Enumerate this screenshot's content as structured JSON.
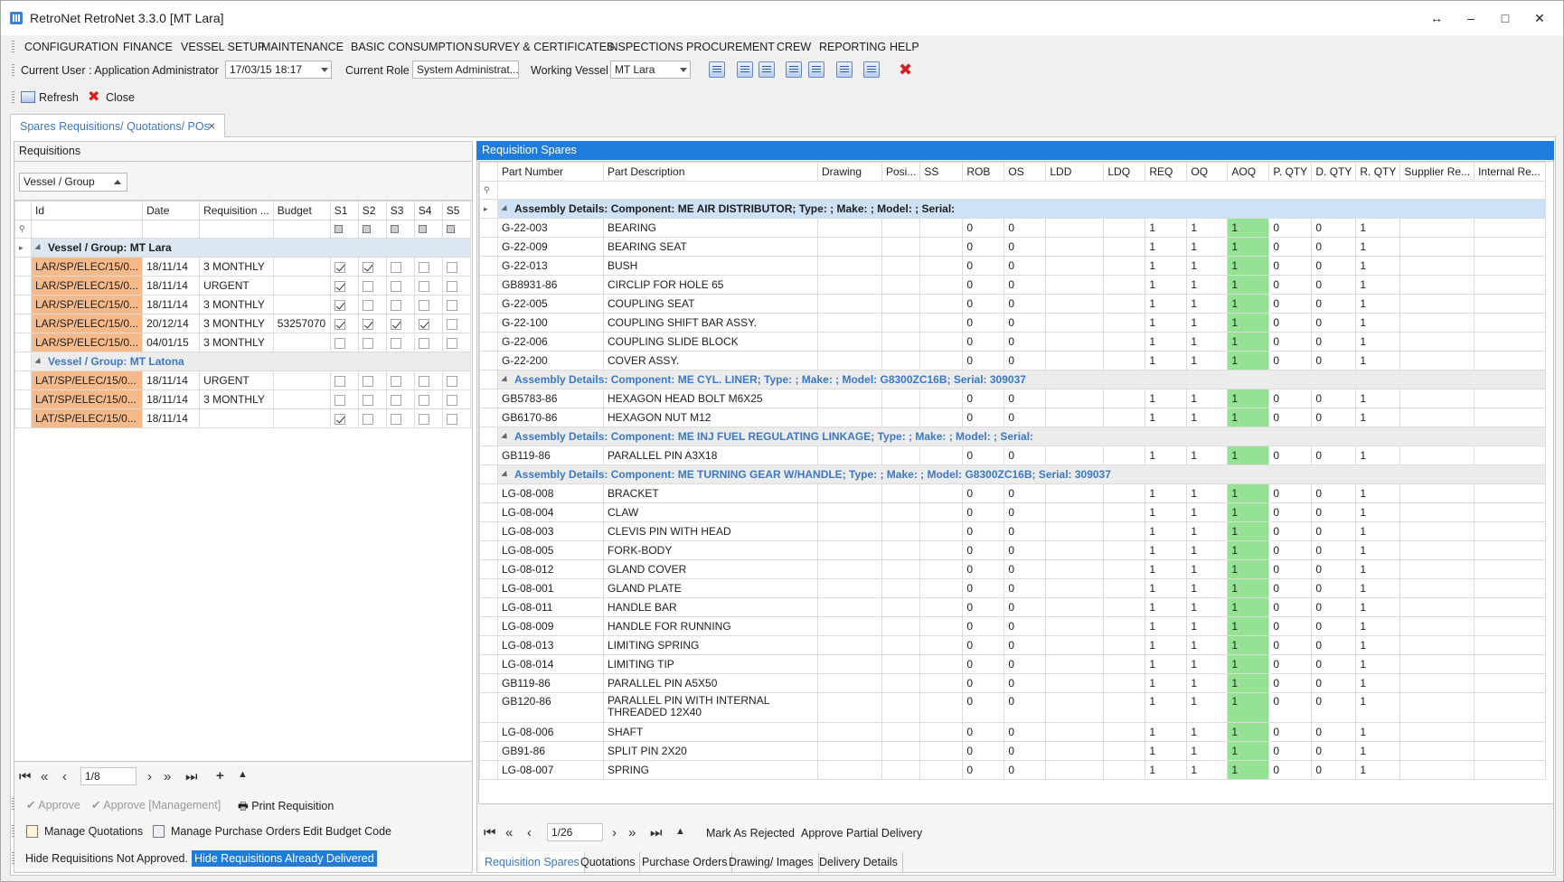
{
  "window": {
    "title": "RetroNet RetroNet 3.3.0 [MT Lara]",
    "controls": [
      "↔",
      "–",
      "□",
      "✕"
    ]
  },
  "menu": [
    "CONFIGURATION",
    "FINANCE",
    "VESSEL SETUP",
    "MAINTENANCE",
    "BASIC CONSUMPTION",
    "SURVEY & CERTIFICATES",
    "INSPECTIONS",
    "PROCUREMENT",
    "CREW",
    "REPORTING",
    "HELP"
  ],
  "toolbar": {
    "current_user_label": "Current User : Application Administrator",
    "date_value": "17/03/15 18:17",
    "current_role_label": "Current Role",
    "role_value": "System Administrat...",
    "working_vessel_label": "Working Vessel",
    "vessel_value": "MT Lara"
  },
  "actions": {
    "refresh": "Refresh",
    "close": "Close"
  },
  "doc_tab": {
    "label": "Spares Requisitions/ Quotations/ POs",
    "close": "×"
  },
  "requisitions": {
    "title": "Requisitions",
    "group_by": "Vessel / Group",
    "columns": [
      "Id",
      "Date",
      "Requisition ...",
      "Budget",
      "S1",
      "S2",
      "S3",
      "S4",
      "S5"
    ],
    "groups": [
      {
        "label": "Vessel / Group: MT Lara",
        "rows": [
          {
            "id": "LAR/SP/ELEC/15/0...",
            "date": "18/11/14",
            "req": "3 MONTHLY",
            "budget": "",
            "s": [
              true,
              true,
              false,
              false,
              false
            ]
          },
          {
            "id": "LAR/SP/ELEC/15/0...",
            "date": "18/11/14",
            "req": "URGENT",
            "budget": "",
            "s": [
              true,
              false,
              false,
              false,
              false
            ]
          },
          {
            "id": "LAR/SP/ELEC/15/0...",
            "date": "18/11/14",
            "req": "3 MONTHLY",
            "budget": "",
            "s": [
              true,
              false,
              false,
              false,
              false
            ]
          },
          {
            "id": "LAR/SP/ELEC/15/0...",
            "date": "20/12/14",
            "req": "3 MONTHLY",
            "budget": "53257070",
            "s": [
              true,
              true,
              true,
              true,
              false
            ]
          },
          {
            "id": "LAR/SP/ELEC/15/0...",
            "date": "04/01/15",
            "req": "3 MONTHLY",
            "budget": "",
            "s": [
              false,
              false,
              false,
              false,
              false
            ]
          }
        ]
      },
      {
        "label": "Vessel / Group: MT Latona",
        "rows": [
          {
            "id": "LAT/SP/ELEC/15/0...",
            "date": "18/11/14",
            "req": "URGENT",
            "budget": "",
            "s": [
              false,
              false,
              false,
              false,
              false
            ]
          },
          {
            "id": "LAT/SP/ELEC/15/0...",
            "date": "18/11/14",
            "req": "3 MONTHLY",
            "budget": "",
            "s": [
              false,
              false,
              false,
              false,
              false
            ]
          },
          {
            "id": "LAT/SP/ELEC/15/0...",
            "date": "18/11/14",
            "req": "",
            "budget": "",
            "s": [
              true,
              false,
              false,
              false,
              false
            ]
          }
        ]
      }
    ],
    "pager": "1/8",
    "approve": "Approve",
    "approve_mgmt": "Approve [Management]",
    "print": "Print Requisition",
    "manage_quotations": "Manage Quotations",
    "manage_pos": "Manage Purchase Orders",
    "edit_budget": "Edit Budget Code",
    "hide_not_approved": "Hide Requisitions Not Approved.",
    "hide_delivered": "Hide Requisitions Already Delivered"
  },
  "spares": {
    "title": "Requisition Spares",
    "columns": [
      "Part Number",
      "Part Description",
      "Drawing",
      "Posi...",
      "SS",
      "ROB",
      "OS",
      "LDD",
      "LDQ",
      "REQ",
      "OQ",
      "AOQ",
      "P. QTY",
      "D. QTY",
      "R. QTY",
      "Supplier Re...",
      "Internal Re..."
    ],
    "assemblies": [
      {
        "label": "Assembly Details: Component: ME AIR DISTRIBUTOR; Type: ; Make: ; Model: ; Serial:",
        "parts": [
          {
            "pn": "G-22-003",
            "desc": "BEARING"
          },
          {
            "pn": "G-22-009",
            "desc": "BEARING SEAT"
          },
          {
            "pn": "G-22-013",
            "desc": "BUSH"
          },
          {
            "pn": "GB8931-86",
            "desc": "CIRCLIP FOR HOLE 65"
          },
          {
            "pn": "G-22-005",
            "desc": "COUPLING SEAT"
          },
          {
            "pn": "G-22-100",
            "desc": "COUPLING SHIFT BAR ASSY."
          },
          {
            "pn": "G-22-006",
            "desc": "COUPLING SLIDE BLOCK"
          },
          {
            "pn": "G-22-200",
            "desc": "COVER ASSY."
          }
        ]
      },
      {
        "label": "Assembly Details: Component: ME CYL. LINER; Type: ; Make: ; Model: G8300ZC16B; Serial: 309037",
        "parts": [
          {
            "pn": "GB5783-86",
            "desc": "HEXAGON HEAD BOLT M6X25"
          },
          {
            "pn": "GB6170-86",
            "desc": "HEXAGON NUT M12"
          }
        ]
      },
      {
        "label": "Assembly Details: Component: ME INJ FUEL REGULATING LINKAGE; Type: ; Make: ; Model: ; Serial:",
        "parts": [
          {
            "pn": "GB119-86",
            "desc": "PARALLEL PIN A3X18"
          }
        ]
      },
      {
        "label": "Assembly Details: Component: ME TURNING GEAR W/HANDLE; Type: ; Make: ; Model: G8300ZC16B; Serial: 309037",
        "parts": [
          {
            "pn": "LG-08-008",
            "desc": "BRACKET"
          },
          {
            "pn": "LG-08-004",
            "desc": "CLAW"
          },
          {
            "pn": "LG-08-003",
            "desc": "CLEVIS PIN WITH HEAD"
          },
          {
            "pn": "LG-08-005",
            "desc": "FORK-BODY"
          },
          {
            "pn": "LG-08-012",
            "desc": "GLAND COVER"
          },
          {
            "pn": "LG-08-001",
            "desc": "GLAND PLATE"
          },
          {
            "pn": "LG-08-011",
            "desc": "HANDLE BAR"
          },
          {
            "pn": "LG-08-009",
            "desc": "HANDLE FOR RUNNING"
          },
          {
            "pn": "LG-08-013",
            "desc": "LIMITING SPRING"
          },
          {
            "pn": "LG-08-014",
            "desc": "LIMITING TIP"
          },
          {
            "pn": "GB119-86",
            "desc": "PARALLEL PIN A5X50"
          },
          {
            "pn": "GB120-86",
            "desc": "PARALLEL PIN WITH INTERNAL THREADED 12X40",
            "tall": true
          },
          {
            "pn": "LG-08-006",
            "desc": "SHAFT"
          },
          {
            "pn": "GB91-86",
            "desc": "SPLIT PIN 2X20"
          },
          {
            "pn": "LG-08-007",
            "desc": "SPRING"
          }
        ]
      }
    ],
    "default_values": {
      "rob": "0",
      "os": "0",
      "req": "1",
      "oq": "1",
      "aoq": "1",
      "pqty": "0",
      "dqty": "0",
      "rqty": "1"
    },
    "pager": "1/26",
    "mark_rejected": "Mark As Rejected",
    "approve_partial": "Approve Partial Delivery"
  },
  "bottom_tabs": [
    "Requisition Spares",
    "Quotations",
    "Purchase Orders",
    "Drawing/ Images",
    "Delivery Details"
  ],
  "colors": {
    "accent": "#1f7cdc",
    "id_cell": "#f5b98a",
    "aoq_cell": "#95e295",
    "group_text": "#3b78c8"
  }
}
